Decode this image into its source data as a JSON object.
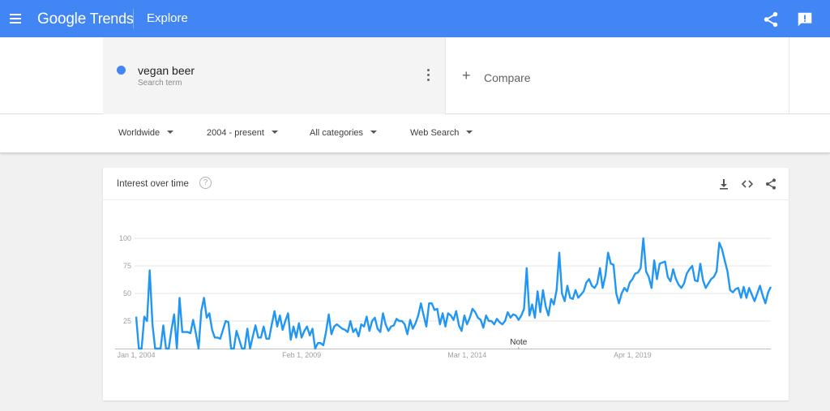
{
  "header": {
    "brand_google": "Google",
    "brand_trends": "Trends",
    "page_title": "Explore",
    "icons": [
      "menu-icon",
      "share-icon",
      "feedback-icon"
    ]
  },
  "search": {
    "term": "vegan beer",
    "term_type": "Search term",
    "term_color": "#4285f4",
    "compare_label": "Compare"
  },
  "filters": [
    {
      "label": "Worldwide"
    },
    {
      "label": "2004 - present"
    },
    {
      "label": "All categories"
    },
    {
      "label": "Web Search"
    }
  ],
  "card": {
    "title": "Interest over time",
    "help_glyph": "?",
    "actions": [
      "download-icon",
      "embed-icon",
      "share-icon"
    ]
  },
  "chart_data": {
    "type": "line",
    "title": "Interest over time",
    "xlabel": "",
    "ylabel": "",
    "ylim": [
      0,
      100
    ],
    "grid": true,
    "y_ticks": [
      25,
      50,
      75,
      100
    ],
    "x_tick_labels": [
      {
        "label": "Jan 1, 2004",
        "index": 0
      },
      {
        "label": "Feb 1, 2009",
        "index": 61
      },
      {
        "label": "Mar 1, 2014",
        "index": 122
      },
      {
        "label": "Apr 1, 2019",
        "index": 183
      }
    ],
    "annotations": [
      {
        "label": "Note",
        "index": 141
      }
    ],
    "line_color": "#2196f3",
    "series": [
      {
        "name": "vegan beer",
        "start": "Jan 2004",
        "frequency": "monthly",
        "values": [
          29,
          0,
          0,
          29,
          25,
          71,
          22,
          0,
          0,
          0,
          21,
          0,
          0,
          17,
          31,
          0,
          46,
          15,
          15,
          15,
          14,
          26,
          14,
          0,
          34,
          46,
          28,
          32,
          17,
          10,
          10,
          9,
          17,
          25,
          24,
          0,
          0,
          16,
          8,
          0,
          0,
          18,
          0,
          11,
          21,
          10,
          10,
          20,
          9,
          9,
          22,
          34,
          20,
          30,
          17,
          25,
          32,
          8,
          20,
          10,
          23,
          10,
          16,
          20,
          12,
          18,
          0,
          5,
          5,
          3,
          15,
          31,
          13,
          20,
          22,
          20,
          18,
          17,
          15,
          25,
          15,
          18,
          11,
          22,
          20,
          29,
          16,
          25,
          28,
          18,
          15,
          32,
          22,
          16,
          20,
          21,
          27,
          25,
          25,
          22,
          13,
          26,
          18,
          23,
          30,
          41,
          30,
          20,
          41,
          41,
          35,
          36,
          22,
          32,
          20,
          32,
          30,
          26,
          34,
          21,
          16,
          30,
          22,
          28,
          36,
          33,
          28,
          26,
          19,
          30,
          25,
          25,
          22,
          27,
          24,
          22,
          25,
          33,
          28,
          31,
          30,
          26,
          30,
          36,
          73,
          30,
          40,
          28,
          52,
          33,
          53,
          38,
          30,
          45,
          40,
          53,
          87,
          50,
          43,
          57,
          46,
          45,
          53,
          46,
          49,
          52,
          60,
          63,
          57,
          55,
          59,
          73,
          55,
          66,
          87,
          77,
          76,
          50,
          41,
          50,
          55,
          52,
          60,
          63,
          68,
          69,
          73,
          100,
          70,
          65,
          55,
          80,
          63,
          77,
          78,
          79,
          65,
          61,
          72,
          63,
          58,
          55,
          59,
          68,
          72,
          75,
          62,
          61,
          77,
          62,
          55,
          59,
          63,
          65,
          70,
          96,
          90,
          80,
          70,
          53,
          51,
          54,
          55,
          46,
          56,
          46,
          55,
          49,
          43,
          50,
          57,
          48,
          41,
          51,
          56
        ]
      }
    ]
  }
}
